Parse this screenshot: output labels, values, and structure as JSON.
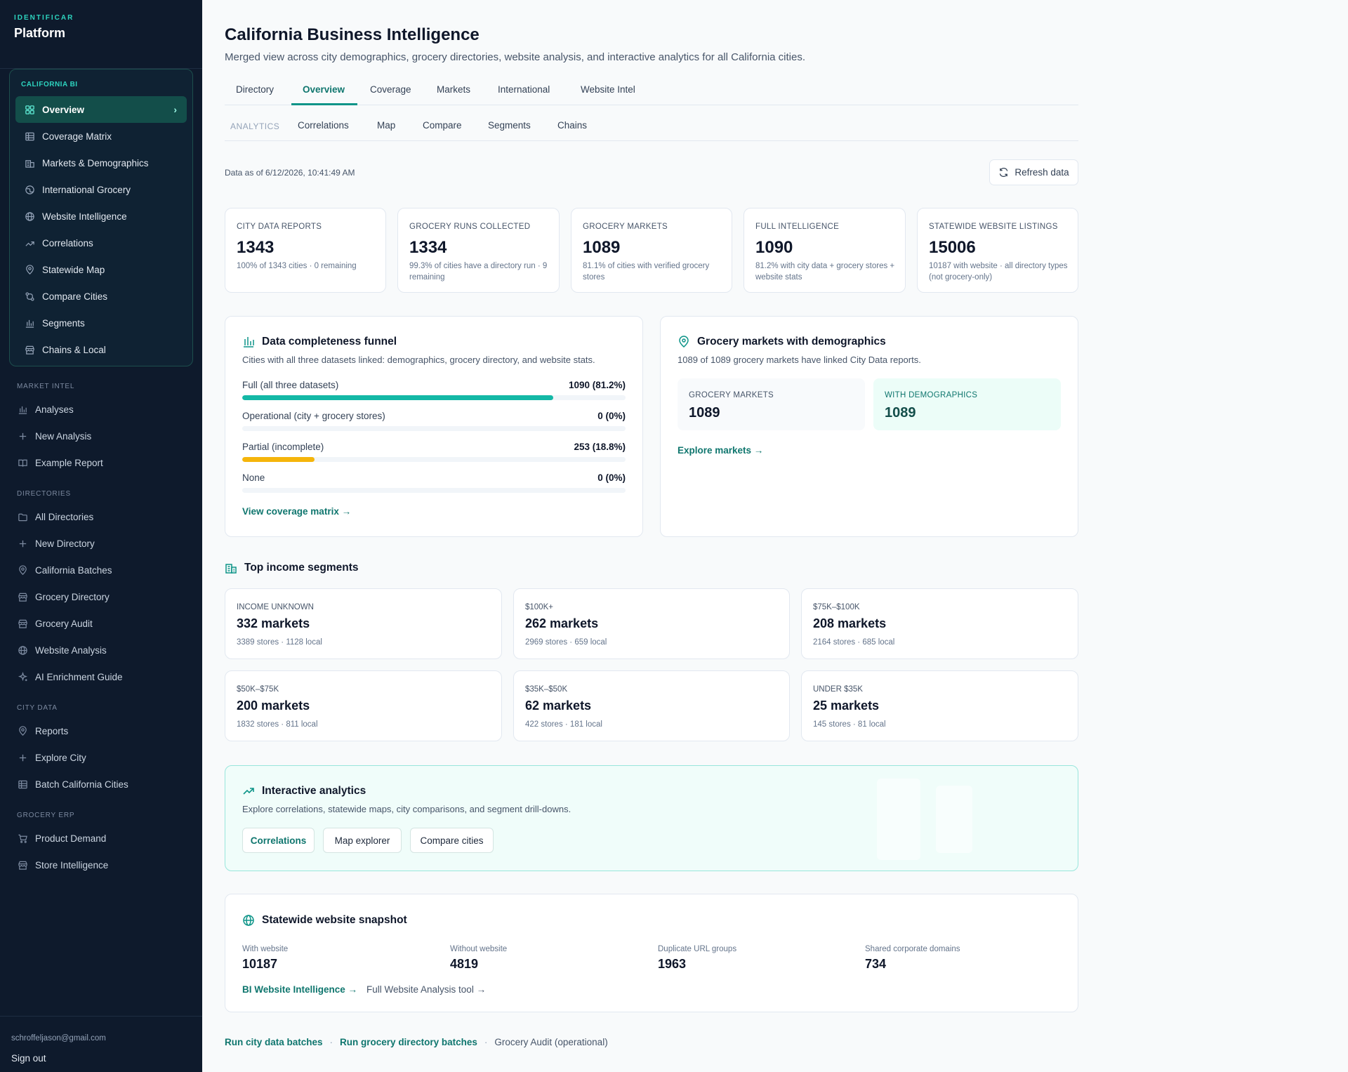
{
  "sidebar": {
    "brand_kicker": "IDENTIFICAR",
    "brand_name": "Platform",
    "bi_section": {
      "title": "CALIFORNIA BI",
      "items": [
        {
          "label": "Overview",
          "icon": "grid-icon",
          "active": true
        },
        {
          "label": "Coverage Matrix",
          "icon": "table-icon"
        },
        {
          "label": "Markets & Demographics",
          "icon": "buildings-icon"
        },
        {
          "label": "International Grocery",
          "icon": "globe-alt-icon"
        },
        {
          "label": "Website Intelligence",
          "icon": "globe-icon"
        },
        {
          "label": "Correlations",
          "icon": "trend-icon"
        },
        {
          "label": "Statewide Map",
          "icon": "pin-icon"
        },
        {
          "label": "Compare Cities",
          "icon": "compare-icon"
        },
        {
          "label": "Segments",
          "icon": "bar-chart-icon"
        },
        {
          "label": "Chains & Local",
          "icon": "store-icon"
        }
      ]
    },
    "market_intel": {
      "title": "MARKET INTEL",
      "items": [
        {
          "label": "Analyses",
          "icon": "bar-chart-icon"
        },
        {
          "label": "New Analysis",
          "icon": "plus-icon"
        },
        {
          "label": "Example Report",
          "icon": "book-icon"
        }
      ]
    },
    "directories": {
      "title": "DIRECTORIES",
      "items": [
        {
          "label": "All Directories",
          "icon": "folder-icon"
        },
        {
          "label": "New Directory",
          "icon": "plus-icon"
        },
        {
          "label": "California Batches",
          "icon": "pin-icon"
        },
        {
          "label": "Grocery Directory",
          "icon": "store-icon"
        },
        {
          "label": "Grocery Audit",
          "icon": "store-icon"
        },
        {
          "label": "Website Analysis",
          "icon": "globe-icon"
        },
        {
          "label": "AI Enrichment Guide",
          "icon": "sparkle-icon"
        }
      ]
    },
    "city_data": {
      "title": "CITY DATA",
      "items": [
        {
          "label": "Reports",
          "icon": "pin-icon"
        },
        {
          "label": "Explore City",
          "icon": "plus-icon"
        },
        {
          "label": "Batch California Cities",
          "icon": "table-icon"
        }
      ]
    },
    "grocery_erp": {
      "title": "GROCERY ERP",
      "items": [
        {
          "label": "Product Demand",
          "icon": "cart-icon"
        },
        {
          "label": "Store Intelligence",
          "icon": "store-icon"
        }
      ]
    },
    "user_email": "schroffeljason@gmail.com",
    "sign_out": "Sign out"
  },
  "header": {
    "title": "California Business Intelligence",
    "subtitle": "Merged view across city demographics, grocery directories, website analysis, and interactive analytics for all California cities."
  },
  "tabs": [
    "Directory",
    "Overview",
    "Coverage",
    "Markets",
    "International",
    "Website Intel"
  ],
  "active_tab": "Overview",
  "subtabs": {
    "label": "ANALYTICS",
    "items": [
      "Correlations",
      "Map",
      "Compare",
      "Segments",
      "Chains"
    ]
  },
  "data_as_of": "Data as of 6/12/2026, 10:41:49 AM",
  "refresh_label": "Refresh data",
  "kpis": [
    {
      "label": "CITY DATA REPORTS",
      "value": "1343",
      "note": "100% of 1343 cities · 0 remaining"
    },
    {
      "label": "GROCERY RUNS COLLECTED",
      "value": "1334",
      "note": "99.3% of cities have a directory run · 9 remaining"
    },
    {
      "label": "GROCERY MARKETS",
      "value": "1089",
      "note": "81.1% of cities with verified grocery stores"
    },
    {
      "label": "FULL INTELLIGENCE",
      "value": "1090",
      "note": "81.2% with city data + grocery stores + website stats"
    },
    {
      "label": "STATEWIDE WEBSITE LISTINGS",
      "value": "15006",
      "note": "10187 with website · all directory types (not grocery-only)"
    }
  ],
  "funnel": {
    "title": "Data completeness funnel",
    "subtitle": "Cities with all three datasets linked: demographics, grocery directory, and website stats.",
    "rows": [
      {
        "label": "Full (all three datasets)",
        "value": "1090 (81.2%)",
        "fraction": 0.812,
        "color": "#14b8a6"
      },
      {
        "label": "Operational (city + grocery stores)",
        "value": "0 (0%)",
        "fraction": 0,
        "color": "#14b8a6"
      },
      {
        "label": "Partial (incomplete)",
        "value": "253 (18.8%)",
        "fraction": 0.188,
        "color": "#f5b50b"
      },
      {
        "label": "None",
        "value": "0 (0%)",
        "fraction": 0,
        "color": "#94a3b8"
      }
    ],
    "link": "View coverage matrix →"
  },
  "markets_demo": {
    "title": "Grocery markets with demographics",
    "subtitle": "1089 of 1089 grocery markets have linked City Data reports.",
    "grocery_markets_label": "GROCERY MARKETS",
    "grocery_markets_value": "1089",
    "with_demo_label": "WITH DEMOGRAPHICS",
    "with_demo_value": "1089",
    "link": "Explore markets →"
  },
  "segments": {
    "title": "Top income segments",
    "items": [
      {
        "label": "INCOME UNKNOWN",
        "value": "332 markets",
        "note": "3389 stores · 1128 local"
      },
      {
        "label": "$100K+",
        "value": "262 markets",
        "note": "2969 stores · 659 local"
      },
      {
        "label": "$75K–$100K",
        "value": "208 markets",
        "note": "2164 stores · 685 local"
      },
      {
        "label": "$50K–$75K",
        "value": "200 markets",
        "note": "1832 stores · 811 local"
      },
      {
        "label": "$35K–$50K",
        "value": "62 markets",
        "note": "422 stores · 181 local"
      },
      {
        "label": "UNDER $35K",
        "value": "25 markets",
        "note": "145 stores · 81 local"
      }
    ]
  },
  "analytics": {
    "title": "Interactive analytics",
    "subtitle": "Explore correlations, statewide maps, city comparisons, and segment drill-downs.",
    "buttons": [
      "Correlations",
      "Map explorer",
      "Compare cities"
    ]
  },
  "website_snapshot": {
    "title": "Statewide website snapshot",
    "stats": [
      {
        "label": "With website",
        "value": "10187"
      },
      {
        "label": "Without website",
        "value": "4819"
      },
      {
        "label": "Duplicate URL groups",
        "value": "1963"
      },
      {
        "label": "Shared corporate domains",
        "value": "734"
      }
    ],
    "link_primary": "BI Website Intelligence →",
    "link_secondary": "Full Website Analysis tool →"
  },
  "footer": {
    "link1": "Run city data batches",
    "link2": "Run grocery directory batches",
    "text3": "Grocery Audit (operational)"
  },
  "colors": {
    "sidebar_bg": "#0e1a2c",
    "accent": "#0d9488",
    "accent_dark": "#0f766e",
    "warning": "#f5b50b"
  }
}
